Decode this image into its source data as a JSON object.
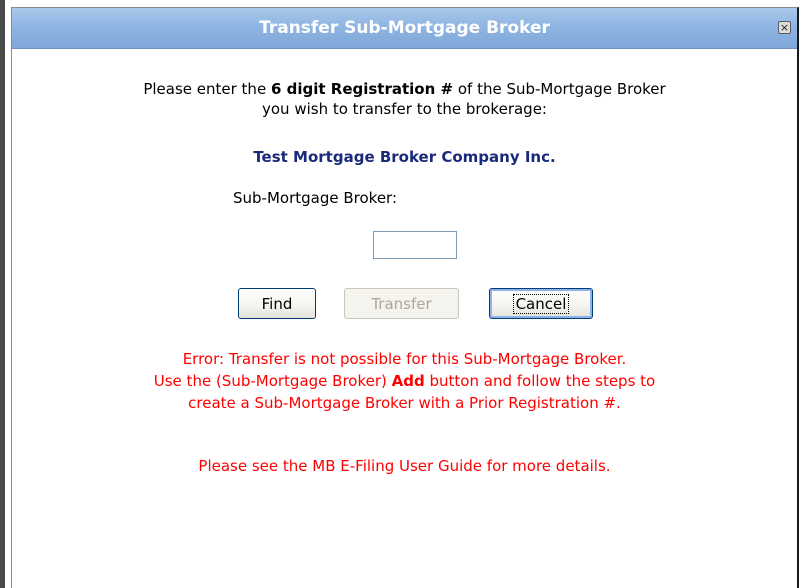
{
  "dialog": {
    "title": "Transfer Sub-Mortgage Broker",
    "close_glyph": "×",
    "close_icon": "close-icon"
  },
  "prompt": {
    "part1": "Please enter the ",
    "bold": "6 digit Registration #",
    "part2": " of the Sub-Mortgage Broker",
    "line2": "you wish to transfer to the brokerage:"
  },
  "company_name": "Test Mortgage Broker Company Inc.",
  "field": {
    "label": "Sub-Mortgage Broker:",
    "value": "",
    "placeholder": ""
  },
  "buttons": {
    "find": "Find",
    "transfer": "Transfer",
    "cancel": "Cancel"
  },
  "error": {
    "line1": "Error: Transfer is not possible for this Sub-Mortgage Broker.",
    "line2_pre": "Use the (Sub-Mortgage Broker) ",
    "line2_bold": "Add",
    "line2_post": " button and follow the steps to",
    "line3": "create a Sub-Mortgage Broker with a Prior Registration #."
  },
  "guide_text": "Please see the MB E-Filing User Guide for more details.",
  "colors": {
    "title_bar": "#8fb5e2",
    "company_text": "#1a2a7a",
    "error_text": "#ff0000"
  }
}
